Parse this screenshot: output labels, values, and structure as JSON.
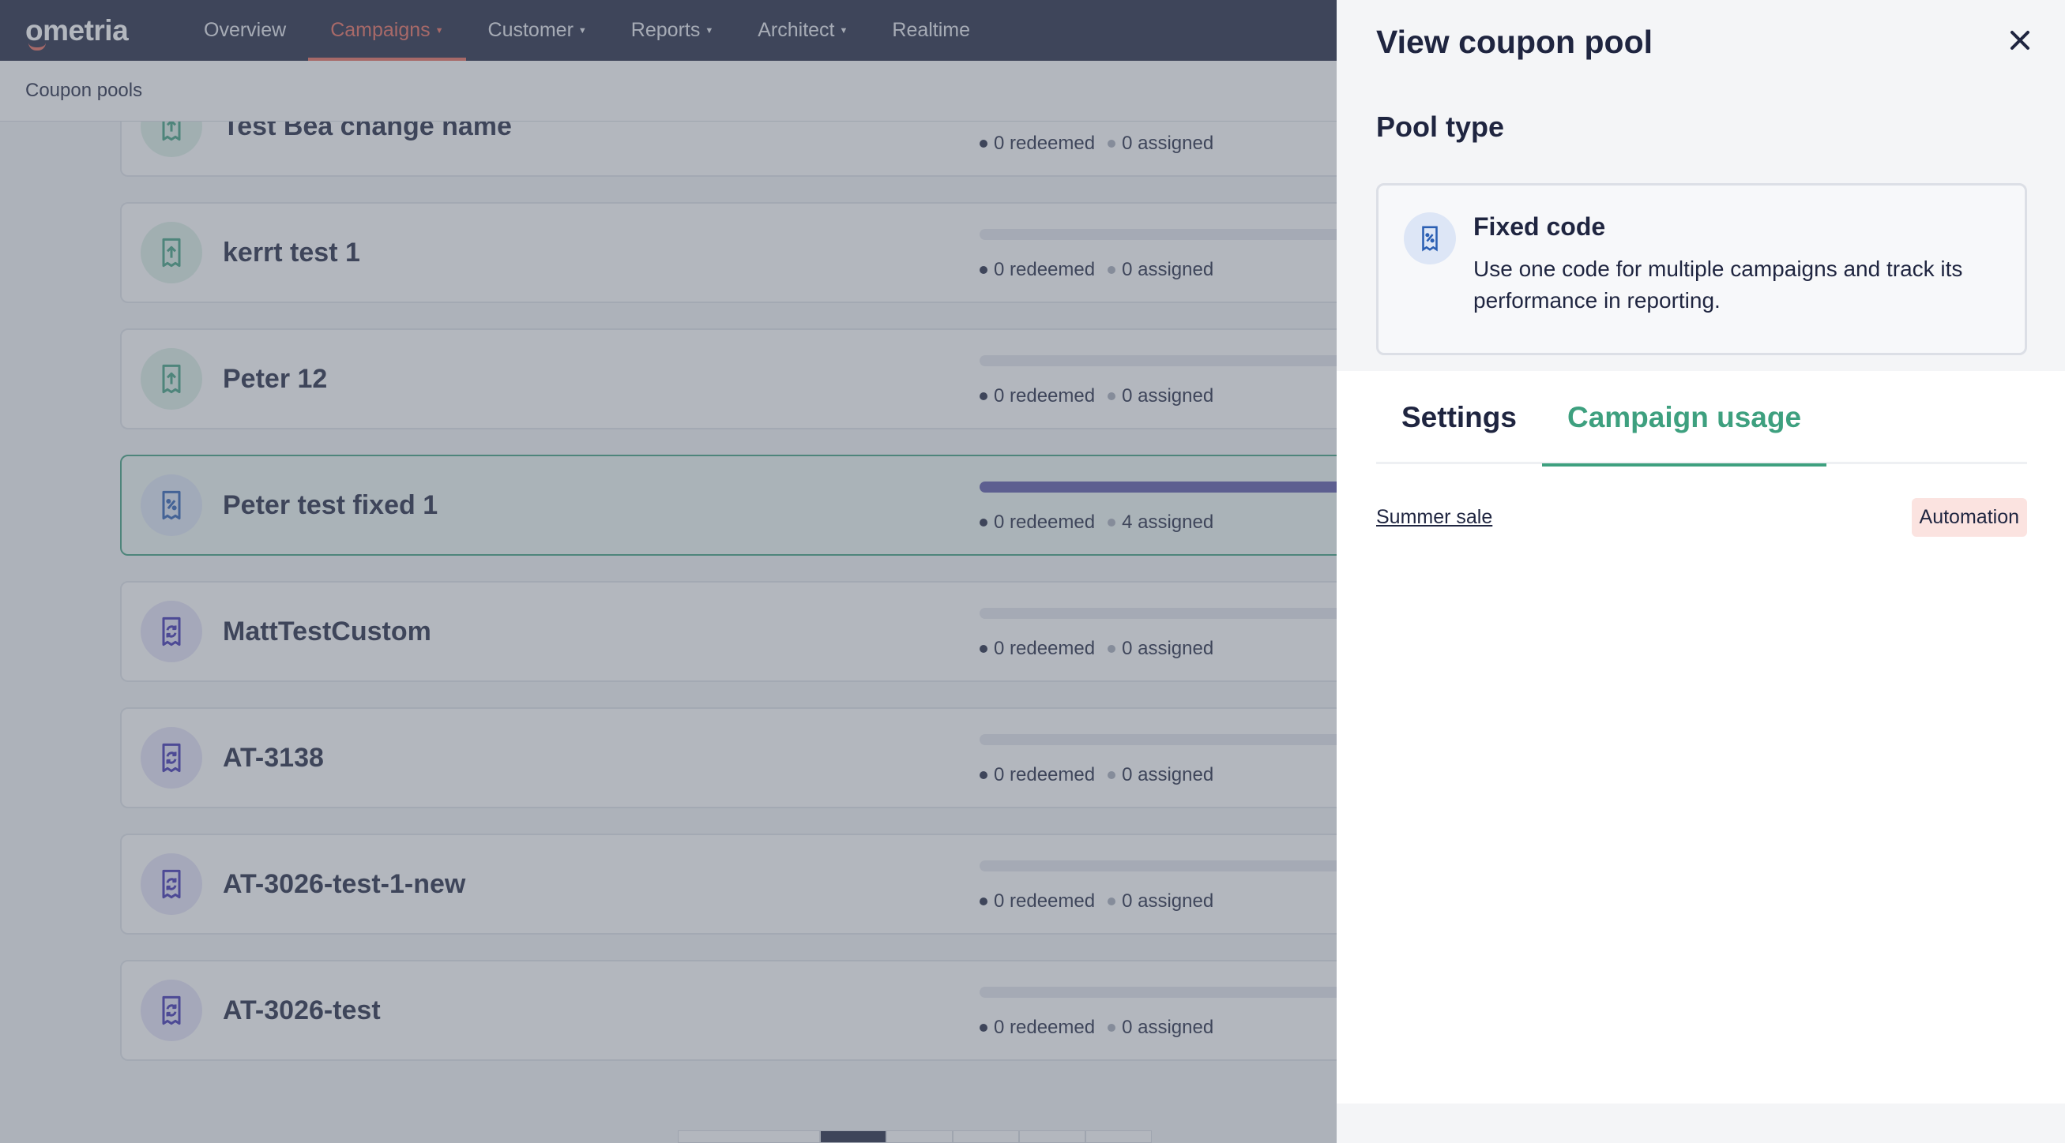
{
  "nav": {
    "logo": "ometria",
    "items": [
      {
        "label": "Overview",
        "dropdown": false,
        "active": false
      },
      {
        "label": "Campaigns",
        "dropdown": true,
        "active": true
      },
      {
        "label": "Customer",
        "dropdown": true,
        "active": false
      },
      {
        "label": "Reports",
        "dropdown": true,
        "active": false
      },
      {
        "label": "Architect",
        "dropdown": true,
        "active": false
      },
      {
        "label": "Realtime",
        "dropdown": false,
        "active": false
      }
    ]
  },
  "subheader": {
    "breadcrumb": "Coupon pools"
  },
  "pools": [
    {
      "name": "Test Bea change name",
      "icon": "upload-coupon-icon",
      "color": "green",
      "redeemed": "0 redeemed",
      "assigned": "0 assigned",
      "fill": 0
    },
    {
      "name": "kerrt test 1",
      "icon": "upload-coupon-icon",
      "color": "green",
      "redeemed": "0 redeemed",
      "assigned": "0 assigned",
      "fill": 0
    },
    {
      "name": "Peter 12",
      "icon": "upload-coupon-icon",
      "color": "green",
      "redeemed": "0 redeemed",
      "assigned": "0 assigned",
      "fill": 0
    },
    {
      "name": "Peter test fixed 1",
      "icon": "fixed-coupon-icon",
      "color": "blue",
      "redeemed": "0 redeemed",
      "assigned": "4 assigned",
      "fill": 1,
      "selected": true
    },
    {
      "name": "MattTestCustom",
      "icon": "generated-coupon-icon",
      "color": "purple",
      "redeemed": "0 redeemed",
      "assigned": "0 assigned",
      "fill": 0
    },
    {
      "name": "AT-3138",
      "icon": "generated-coupon-icon",
      "color": "purple",
      "redeemed": "0 redeemed",
      "assigned": "0 assigned",
      "fill": 0
    },
    {
      "name": "AT-3026-test-1-new",
      "icon": "generated-coupon-icon",
      "color": "purple",
      "redeemed": "0 redeemed",
      "assigned": "0 assigned",
      "fill": 0
    },
    {
      "name": "AT-3026-test",
      "icon": "generated-coupon-icon",
      "color": "purple",
      "redeemed": "0 redeemed",
      "assigned": "0 assigned",
      "fill": 0
    }
  ],
  "drawer": {
    "title": "View coupon pool",
    "close_icon": "close-icon",
    "pool_type_heading": "Pool type",
    "pool_type": {
      "icon": "fixed-coupon-icon",
      "title": "Fixed code",
      "description": "Use one code for multiple campaigns and track its performance in reporting."
    },
    "tabs": [
      {
        "label": "Settings",
        "active": false
      },
      {
        "label": "Campaign usage",
        "active": true
      }
    ],
    "campaign_usage": [
      {
        "name": "Summer sale",
        "type": "Automation"
      }
    ]
  },
  "colors": {
    "nav_bg": "#1f2540",
    "accent_red": "#e96a5b",
    "accent_green": "#3ea07f",
    "badge_bg": "#fbe3e0",
    "progress_fill": "#5b57a8"
  }
}
